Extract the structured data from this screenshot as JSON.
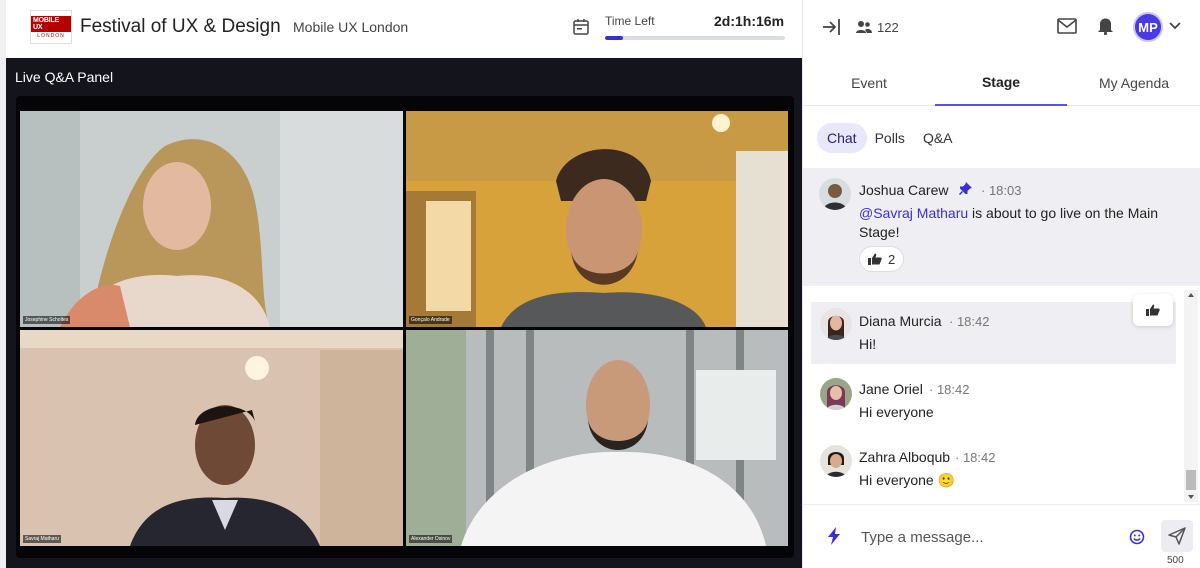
{
  "header": {
    "logo_line1": "MOBILE UX",
    "logo_line2": "LONDON",
    "event_title": "Festival of UX & Design",
    "organizer": "Mobile UX London",
    "time_left_label": "Time Left",
    "time_left_value": "2d:1h:16m",
    "time_progress_fraction": 0.1
  },
  "stage": {
    "panel_title": "Live Q&A Panel",
    "participants": [
      {
        "name": "Josephine Scholtes"
      },
      {
        "name": "Gonçalo Andrade"
      },
      {
        "name": "Savraj Matharu"
      },
      {
        "name": "Alexander Osinov"
      }
    ]
  },
  "topbar": {
    "attendee_count": "122",
    "user_initials": "MP"
  },
  "tabs": [
    {
      "label": "Event",
      "active": false
    },
    {
      "label": "Stage",
      "active": true
    },
    {
      "label": "My Agenda",
      "active": false
    }
  ],
  "subtabs": [
    {
      "label": "Chat",
      "active": true
    },
    {
      "label": "Polls",
      "active": false
    },
    {
      "label": "Q&A",
      "active": false
    }
  ],
  "pinned_message": {
    "author": "Joshua Carew",
    "time": "18:03",
    "mention": "@Savraj Matharu",
    "text_line1_rest": " is about to go live on the Main",
    "text_line2": "Stage!",
    "reaction_count": "2"
  },
  "messages": [
    {
      "author": "Diana Murcia",
      "time": "18:42",
      "text": "Hi!"
    },
    {
      "author": "Jane Oriel",
      "time": "18:42",
      "text": "Hi everyone"
    },
    {
      "author": "Zahra Alboqub",
      "time": "18:42",
      "text": "Hi everyone 🙂"
    }
  ],
  "composer": {
    "placeholder": "Type a message...",
    "char_limit": "500"
  },
  "colors": {
    "accent": "#3a2fd6",
    "stage_bg": "#14141c",
    "panel_bg": "#eeeef3"
  },
  "icons": [
    "calendar-icon",
    "exit-icon",
    "people-icon",
    "mail-icon",
    "bell-icon",
    "chevron-down-icon",
    "pin-icon",
    "thumbs-up-icon",
    "bolt-icon",
    "emoji-icon",
    "send-icon"
  ]
}
